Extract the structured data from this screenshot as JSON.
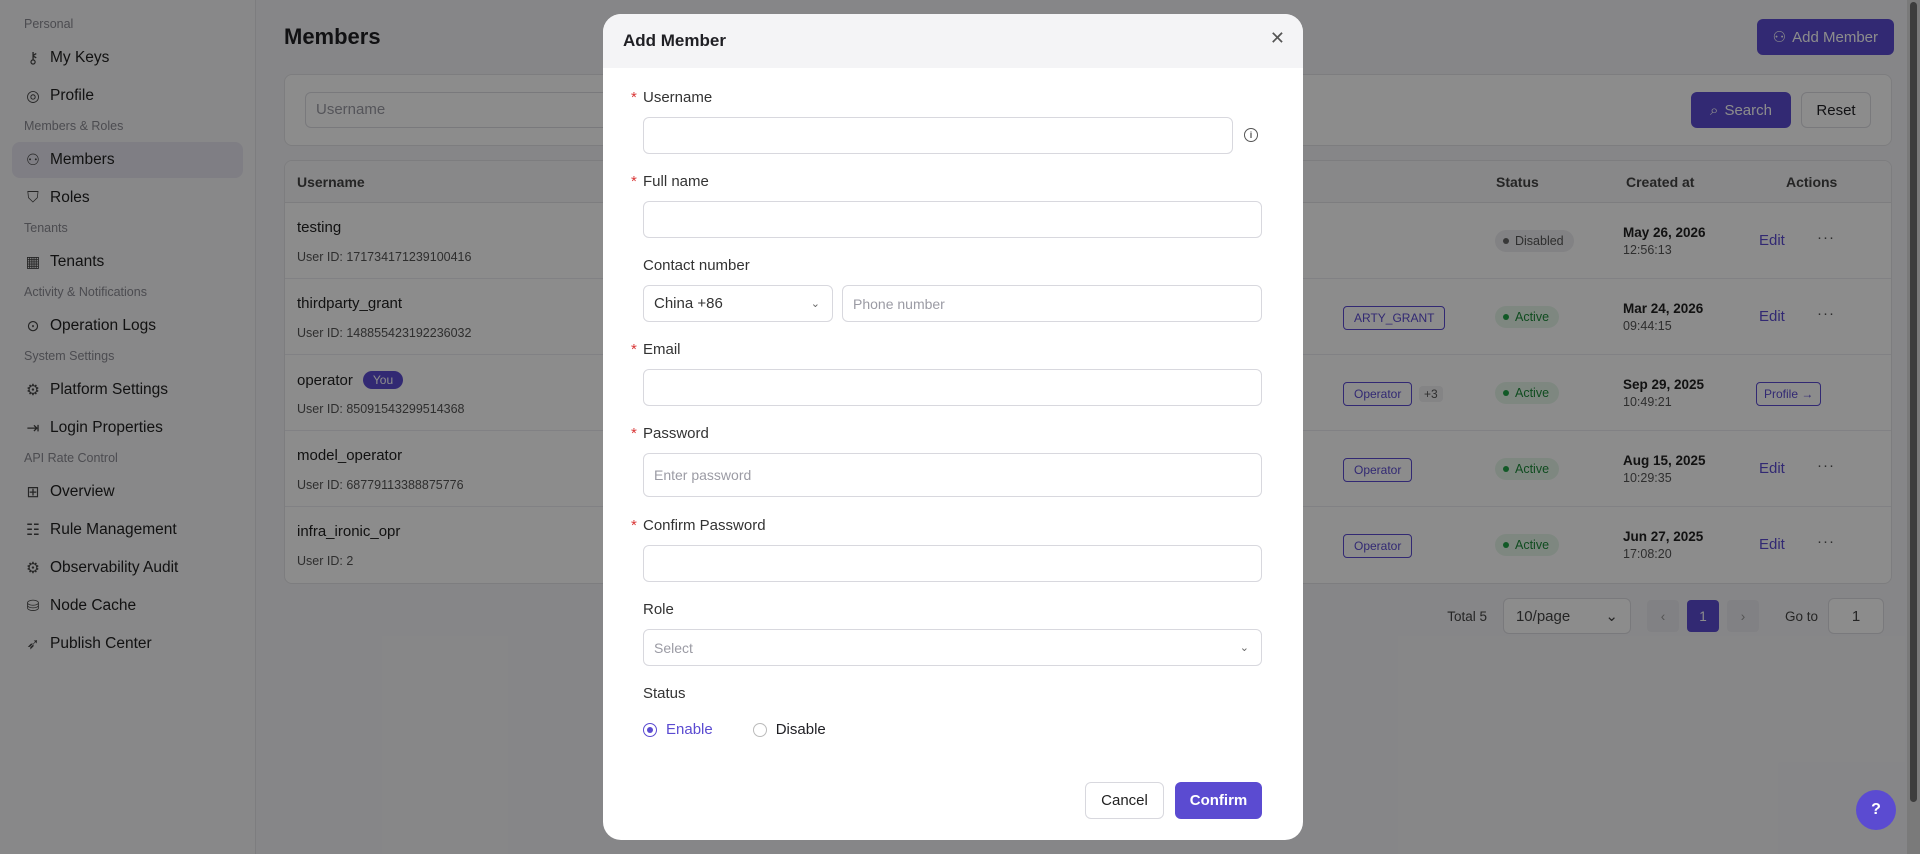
{
  "sidebar": {
    "groups": [
      {
        "title": "Personal",
        "items": [
          {
            "label": "My Keys",
            "icon": "key-icon"
          },
          {
            "label": "Profile",
            "icon": "user-circle-icon"
          }
        ]
      },
      {
        "title": "Members & Roles",
        "items": [
          {
            "label": "Members",
            "icon": "users-icon",
            "active": true
          },
          {
            "label": "Roles",
            "icon": "shield-icon"
          }
        ]
      },
      {
        "title": "Tenants",
        "items": [
          {
            "label": "Tenants",
            "icon": "building-icon"
          }
        ]
      },
      {
        "title": "Activity & Notifications",
        "items": [
          {
            "label": "Operation Logs",
            "icon": "log-icon"
          }
        ]
      },
      {
        "title": "System Settings",
        "items": [
          {
            "label": "Platform Settings",
            "icon": "gear-icon"
          },
          {
            "label": "Login Properties",
            "icon": "login-icon"
          }
        ]
      },
      {
        "title": "API Rate Control",
        "items": [
          {
            "label": "Overview",
            "icon": "grid-icon"
          },
          {
            "label": "Rule Management",
            "icon": "list-icon"
          },
          {
            "label": "Observability Audit",
            "icon": "eye-gear-icon"
          },
          {
            "label": "Node Cache",
            "icon": "database-icon"
          },
          {
            "label": "Publish Center",
            "icon": "rocket-icon"
          }
        ]
      }
    ]
  },
  "main": {
    "title": "Members",
    "add_button": "Add Member",
    "filter": {
      "username_placeholder": "Username",
      "search_label": "Search",
      "reset_label": "Reset"
    },
    "table": {
      "headers": {
        "username": "Username",
        "status": "Status",
        "created": "Created at",
        "actions": "Actions"
      },
      "rows": [
        {
          "username": "testing",
          "uid_label": "User ID:",
          "uid": "171734171239100416",
          "status": "Disabled",
          "date": "May 26, 2026",
          "time": "12:56:13",
          "action": "Edit"
        },
        {
          "username": "thirdparty_grant",
          "uid_label": "User ID:",
          "uid": "148855423192236032",
          "role": "ARTY_GRANT",
          "status": "Active",
          "date": "Mar 24, 2026",
          "time": "09:44:15",
          "action": "Edit"
        },
        {
          "username": "operator",
          "you_badge": "You",
          "uid_label": "User ID:",
          "uid": "85091543299514368",
          "role": "Operator",
          "extra": "+3",
          "status": "Active",
          "date": "Sep 29, 2025",
          "time": "10:49:21",
          "action": "Profile →"
        },
        {
          "username": "model_operator",
          "uid_label": "User ID:",
          "uid": "68779113388875776",
          "role": "Operator",
          "status": "Active",
          "date": "Aug 15, 2025",
          "time": "10:29:35",
          "action": "Edit"
        },
        {
          "username": "infra_ironic_opr",
          "uid_label": "User ID:",
          "uid": "2",
          "role": "Operator",
          "status": "Active",
          "date": "Jun 27, 2025",
          "time": "17:08:20",
          "action": "Edit"
        }
      ]
    },
    "pager": {
      "total": "Total 5",
      "page_size": "10/page",
      "current": "1",
      "goto_label": "Go to",
      "goto_value": "1"
    }
  },
  "modal": {
    "title": "Add Member",
    "username_label": "Username",
    "fullname_label": "Full name",
    "contact_label": "Contact number",
    "country_value": "China +86",
    "phone_placeholder": "Phone number",
    "email_label": "Email",
    "password_label": "Password",
    "password_placeholder": "Enter password",
    "confirm_password_label": "Confirm Password",
    "role_label": "Role",
    "role_placeholder": "Select",
    "status_label": "Status",
    "enable_label": "Enable",
    "disable_label": "Disable",
    "cancel_label": "Cancel",
    "confirm_label": "Confirm",
    "required_mark": "*"
  },
  "colors": {
    "accent": "#5b4bd1",
    "active": "#22a447",
    "danger": "#d93636"
  }
}
